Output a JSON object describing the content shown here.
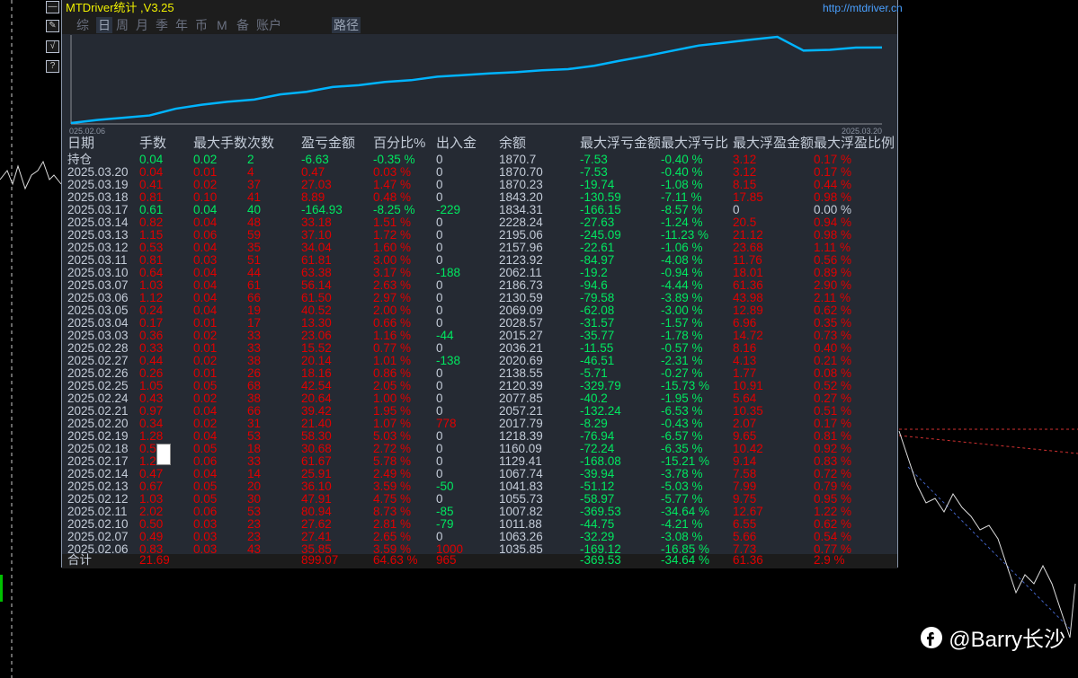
{
  "window": {
    "title": "MTDriver统计 ,V3.25",
    "url": "http://mtdriver.cn"
  },
  "side_buttons": [
    {
      "icon": "minimize-icon",
      "label": "—"
    },
    {
      "icon": "edit-icon",
      "label": "✎"
    },
    {
      "icon": "check-icon",
      "label": "√"
    },
    {
      "icon": "help-icon",
      "label": "?"
    }
  ],
  "tabs": [
    {
      "label": "综",
      "active": false
    },
    {
      "label": "日",
      "active": true
    },
    {
      "label": "周",
      "active": false
    },
    {
      "label": "月",
      "active": false
    },
    {
      "label": "季",
      "active": false
    },
    {
      "label": "年",
      "active": false
    },
    {
      "label": "币",
      "active": false
    },
    {
      "label": "M",
      "active": false
    },
    {
      "label": "备",
      "active": false
    },
    {
      "label": "账户",
      "active": false
    },
    {
      "label": "路径",
      "active": true
    }
  ],
  "chart_data": {
    "type": "line",
    "x_start_label": "025.02.06",
    "x_end_label": "2025.03.20",
    "line_color": "#00b4ff"
  },
  "table": {
    "headers": [
      "日期",
      "手数",
      "最大手数",
      "次数",
      "盈亏金额",
      "百分比%",
      "出入金",
      "余额",
      "最大浮亏金额",
      "最大浮亏比",
      "最大浮盈金额",
      "最大浮盈比例"
    ],
    "rows": [
      [
        "持仓",
        "0.04",
        "0.02",
        "2",
        "-6.63",
        "-0.35 %",
        "0",
        "1870.7",
        "-7.53",
        "-0.40 %",
        "3.12",
        "0.17 %"
      ],
      [
        "2025.03.20",
        "0.04",
        "0.01",
        "4",
        "0.47",
        "0.03 %",
        "0",
        "1870.70",
        "-7.53",
        "-0.40 %",
        "3.12",
        "0.17 %"
      ],
      [
        "2025.03.19",
        "0.41",
        "0.02",
        "37",
        "27.03",
        "1.47 %",
        "0",
        "1870.23",
        "-19.74",
        "-1.08 %",
        "8.15",
        "0.44 %"
      ],
      [
        "2025.03.18",
        "0.81",
        "0.10",
        "41",
        "8.89",
        "0.48 %",
        "0",
        "1843.20",
        "-130.59",
        "-7.11 %",
        "17.85",
        "0.98 %"
      ],
      [
        "2025.03.17",
        "0.61",
        "0.04",
        "40",
        "-164.93",
        "-8.25 %",
        "-229",
        "1834.31",
        "-166.15",
        "-8.57 %",
        "0",
        "0.00 %"
      ],
      [
        "2025.03.14",
        "0.82",
        "0.04",
        "48",
        "33.18",
        "1.51 %",
        "0",
        "2228.24",
        "-27.63",
        "-1.24 %",
        "20.5",
        "0.94 %"
      ],
      [
        "2025.03.13",
        "1.15",
        "0.06",
        "59",
        "37.10",
        "1.72 %",
        "0",
        "2195.06",
        "-245.09",
        "-11.23 %",
        "21.12",
        "0.98 %"
      ],
      [
        "2025.03.12",
        "0.53",
        "0.04",
        "35",
        "34.04",
        "1.60 %",
        "0",
        "2157.96",
        "-22.61",
        "-1.06 %",
        "23.68",
        "1.11 %"
      ],
      [
        "2025.03.11",
        "0.81",
        "0.03",
        "51",
        "61.81",
        "3.00 %",
        "0",
        "2123.92",
        "-84.97",
        "-4.08 %",
        "11.76",
        "0.56 %"
      ],
      [
        "2025.03.10",
        "0.64",
        "0.04",
        "44",
        "63.38",
        "3.17 %",
        "-188",
        "2062.11",
        "-19.2",
        "-0.94 %",
        "18.01",
        "0.89 %"
      ],
      [
        "2025.03.07",
        "1.03",
        "0.04",
        "61",
        "56.14",
        "2.63 %",
        "0",
        "2186.73",
        "-94.6",
        "-4.44 %",
        "61.36",
        "2.90 %"
      ],
      [
        "2025.03.06",
        "1.12",
        "0.04",
        "66",
        "61.50",
        "2.97 %",
        "0",
        "2130.59",
        "-79.58",
        "-3.89 %",
        "43.98",
        "2.11 %"
      ],
      [
        "2025.03.05",
        "0.24",
        "0.04",
        "19",
        "40.52",
        "2.00 %",
        "0",
        "2069.09",
        "-62.08",
        "-3.00 %",
        "12.89",
        "0.62 %"
      ],
      [
        "2025.03.04",
        "0.17",
        "0.01",
        "17",
        "13.30",
        "0.66 %",
        "0",
        "2028.57",
        "-31.57",
        "-1.57 %",
        "6.96",
        "0.35 %"
      ],
      [
        "2025.03.03",
        "0.36",
        "0.02",
        "33",
        "23.06",
        "1.16 %",
        "-44",
        "2015.27",
        "-35.77",
        "-1.78 %",
        "14.72",
        "0.73 %"
      ],
      [
        "2025.02.28",
        "0.33",
        "0.01",
        "33",
        "15.52",
        "0.77 %",
        "0",
        "2036.21",
        "-11.55",
        "-0.57 %",
        "8.16",
        "0.40 %"
      ],
      [
        "2025.02.27",
        "0.44",
        "0.02",
        "38",
        "20.14",
        "1.01 %",
        "-138",
        "2020.69",
        "-46.51",
        "-2.31 %",
        "4.13",
        "0.21 %"
      ],
      [
        "2025.02.26",
        "0.26",
        "0.01",
        "26",
        "18.16",
        "0.86 %",
        "0",
        "2138.55",
        "-5.71",
        "-0.27 %",
        "1.77",
        "0.08 %"
      ],
      [
        "2025.02.25",
        "1.05",
        "0.05",
        "68",
        "42.54",
        "2.05 %",
        "0",
        "2120.39",
        "-329.79",
        "-15.73 %",
        "10.91",
        "0.52 %"
      ],
      [
        "2025.02.24",
        "0.43",
        "0.02",
        "38",
        "20.64",
        "1.00 %",
        "0",
        "2077.85",
        "-40.2",
        "-1.95 %",
        "5.64",
        "0.27 %"
      ],
      [
        "2025.02.21",
        "0.97",
        "0.04",
        "66",
        "39.42",
        "1.95 %",
        "0",
        "2057.21",
        "-132.24",
        "-6.53 %",
        "10.35",
        "0.51 %"
      ],
      [
        "2025.02.20",
        "0.34",
        "0.02",
        "31",
        "21.40",
        "1.07 %",
        "778",
        "2017.79",
        "-8.29",
        "-0.43 %",
        "2.07",
        "0.17 %"
      ],
      [
        "2025.02.19",
        "1.28",
        "0.04",
        "53",
        "58.30",
        "5.03 %",
        "0",
        "1218.39",
        "-76.94",
        "-6.57 %",
        "9.65",
        "0.81 %"
      ],
      [
        "2025.02.18",
        "0.5",
        "0.05",
        "18",
        "30.68",
        "2.72 %",
        "0",
        "1160.09",
        "-72.24",
        "-6.35 %",
        "10.42",
        "0.92 %"
      ],
      [
        "2025.02.17",
        "1.2",
        "0.06",
        "33",
        "61.67",
        "5.78 %",
        "0",
        "1129.41",
        "-168.08",
        "-15.21 %",
        "9.14",
        "0.83 %"
      ],
      [
        "2025.02.14",
        "0.47",
        "0.04",
        "14",
        "25.91",
        "2.49 %",
        "0",
        "1067.74",
        "-39.94",
        "-3.78 %",
        "7.58",
        "0.72 %"
      ],
      [
        "2025.02.13",
        "0.67",
        "0.05",
        "20",
        "36.10",
        "3.59 %",
        "-50",
        "1041.83",
        "-51.12",
        "-5.03 %",
        "7.99",
        "0.79 %"
      ],
      [
        "2025.02.12",
        "1.03",
        "0.05",
        "30",
        "47.91",
        "4.75 %",
        "0",
        "1055.73",
        "-58.97",
        "-5.77 %",
        "9.75",
        "0.95 %"
      ],
      [
        "2025.02.11",
        "2.02",
        "0.06",
        "53",
        "80.94",
        "8.73 %",
        "-85",
        "1007.82",
        "-369.53",
        "-34.64 %",
        "12.67",
        "1.22 %"
      ],
      [
        "2025.02.10",
        "0.50",
        "0.03",
        "23",
        "27.62",
        "2.81 %",
        "-79",
        "1011.88",
        "-44.75",
        "-4.21 %",
        "6.55",
        "0.62 %"
      ],
      [
        "2025.02.07",
        "0.49",
        "0.03",
        "23",
        "27.41",
        "2.65 %",
        "0",
        "1063.26",
        "-32.29",
        "-3.08 %",
        "5.66",
        "0.54 %"
      ],
      [
        "2025.02.06",
        "0.83",
        "0.03",
        "43",
        "35.85",
        "3.59 %",
        "1000",
        "1035.85",
        "-169.12",
        "-16.85 %",
        "7.73",
        "0.77 %"
      ]
    ],
    "total": [
      "合计",
      "21.69",
      "",
      "",
      "899.07",
      "64.63 %",
      "965",
      "",
      "-369.53",
      "-34.64 %",
      "61.36",
      "2.9 %"
    ]
  },
  "colors": {
    "profit": "#e00000",
    "loss": "#00e860",
    "neutral": "#c4ccd8"
  },
  "watermark": {
    "icon": "facebook-icon",
    "text": "@Barry长沙"
  }
}
